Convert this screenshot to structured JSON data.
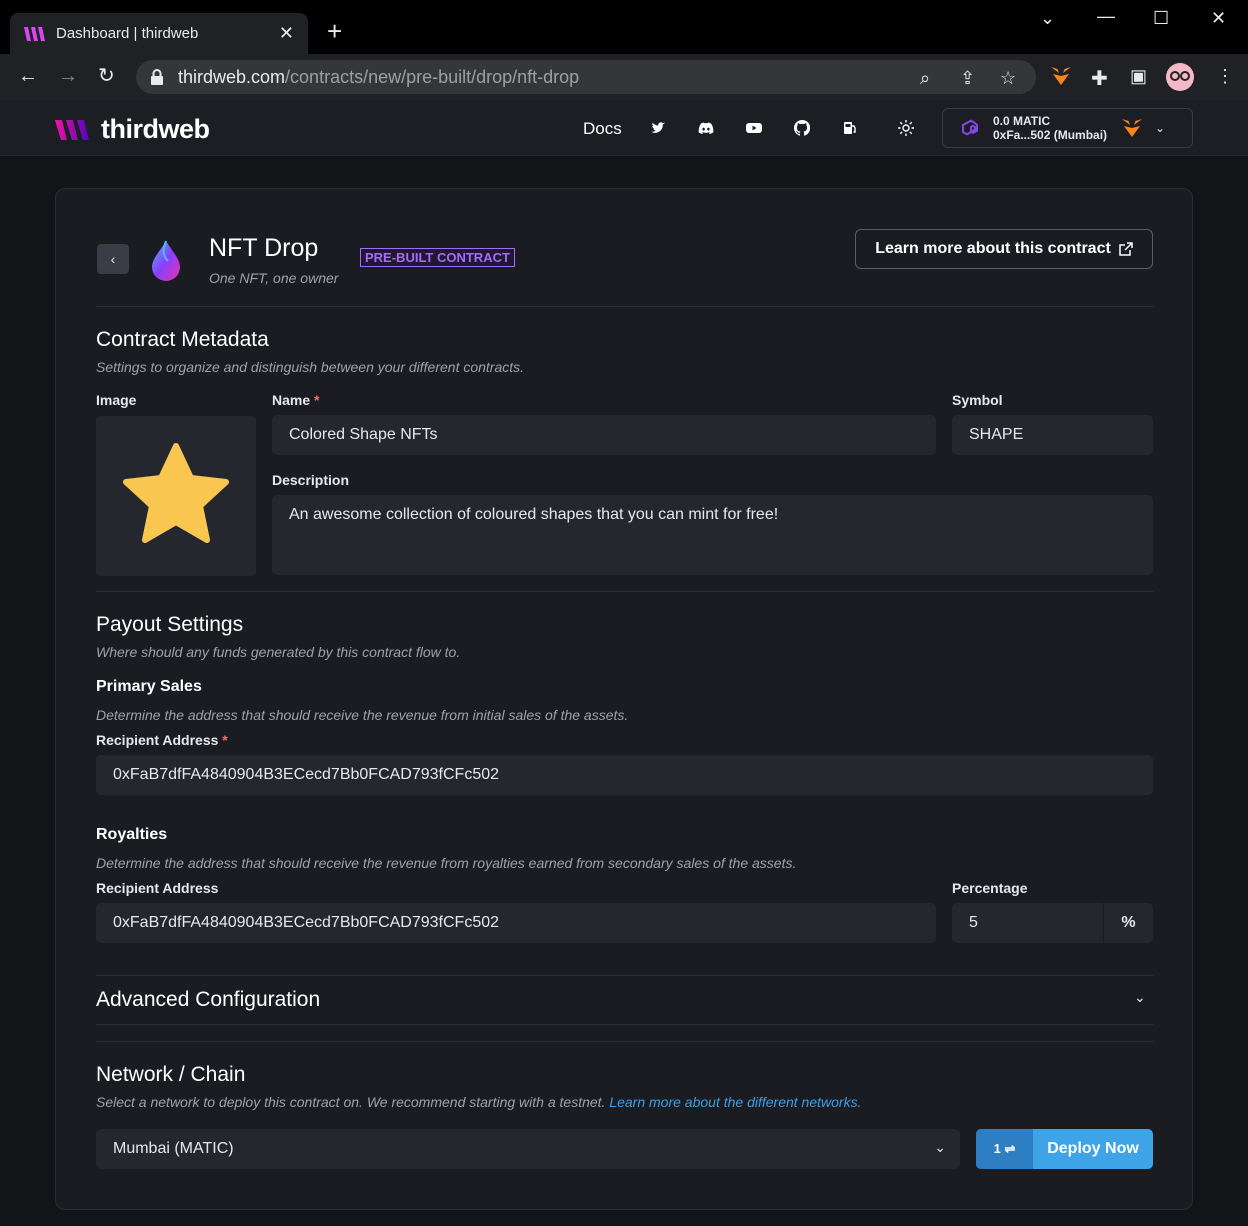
{
  "browser": {
    "tab_title": "Dashboard | thirdweb",
    "url_host": "thirdweb.com",
    "url_path": "/contracts/new/pre-built/drop/nft-drop"
  },
  "header": {
    "brand": "thirdweb",
    "docs_label": "Docs",
    "wallet_balance": "0.0 MATIC",
    "wallet_address": "0xFa...502 (Mumbai)"
  },
  "contract": {
    "title": "NFT Drop",
    "subtitle": "One NFT, one owner",
    "badge": "PRE-BUILT CONTRACT",
    "learn_more": "Learn more about this contract"
  },
  "metadata": {
    "title": "Contract Metadata",
    "subtitle": "Settings to organize and distinguish between your different contracts.",
    "image_label": "Image",
    "name_label": "Name",
    "name_value": "Colored Shape NFTs",
    "symbol_label": "Symbol",
    "symbol_value": "SHAPE",
    "description_label": "Description",
    "description_value": "An awesome collection of coloured shapes that you can mint for free!"
  },
  "payout": {
    "title": "Payout Settings",
    "subtitle": "Where should any funds generated by this contract flow to.",
    "primary_title": "Primary Sales",
    "primary_sub": "Determine the address that should receive the revenue from initial sales of the assets.",
    "primary_label": "Recipient Address",
    "primary_value": "0xFaB7dfFA4840904B3ECecd7Bb0FCAD793fCFc502",
    "royalties_title": "Royalties",
    "royalties_sub": "Determine the address that should receive the revenue from royalties earned from secondary sales of the assets.",
    "royalties_label": "Recipient Address",
    "royalties_value": "0xFaB7dfFA4840904B3ECecd7Bb0FCAD793fCFc502",
    "percentage_label": "Percentage",
    "percentage_value": "5",
    "percentage_suffix": "%"
  },
  "advanced": {
    "title": "Advanced Configuration"
  },
  "network": {
    "title": "Network / Chain",
    "subtitle": "Select a network to deploy this contract on. We recommend starting with a testnet.",
    "link": "Learn more about the different networks.",
    "selected": "Mumbai (MATIC)",
    "tx_count": "1 ⇌",
    "deploy_label": "Deploy Now"
  },
  "colors": {
    "accent": "#3fa3e8",
    "badge": "#a36cff",
    "star": "#f9c74f"
  }
}
